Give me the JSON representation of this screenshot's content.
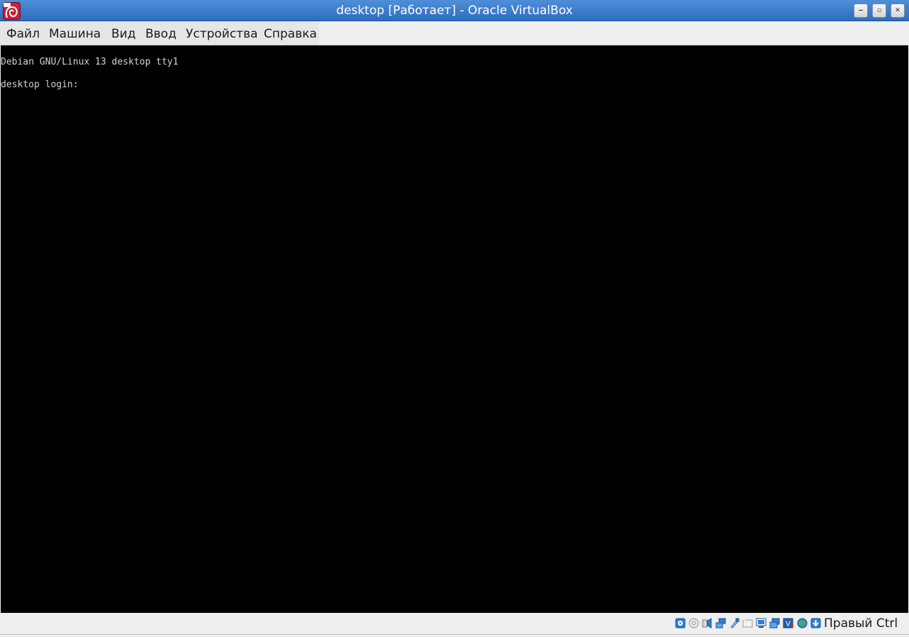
{
  "window": {
    "title": "desktop [Работает] - Oracle VirtualBox",
    "controls": {
      "minimize": "‒",
      "maximize": "▫",
      "close": "✕"
    },
    "app_icon": "virtualbox-app-icon"
  },
  "menu": {
    "items": [
      {
        "label": "Файл"
      },
      {
        "label": "Машина"
      },
      {
        "label": "Вид"
      },
      {
        "label": "Ввод"
      },
      {
        "label": "Устройства"
      },
      {
        "label": "Справка"
      }
    ]
  },
  "console": {
    "lines": [
      "Debian GNU/Linux 13 desktop tty1",
      "desktop login:"
    ],
    "background": "#000000",
    "text_color": "#d3d3d3"
  },
  "status_bar": {
    "indicators": [
      {
        "icon": "hard-disk-icon"
      },
      {
        "icon": "optical-drive-icon"
      },
      {
        "icon": "audio-icon"
      },
      {
        "icon": "network-icon"
      },
      {
        "icon": "usb-icon"
      },
      {
        "icon": "shared-folders-icon"
      },
      {
        "icon": "display-icon"
      },
      {
        "icon": "recording-icon"
      },
      {
        "icon": "virtualization-icon"
      },
      {
        "icon": "guest-additions-icon"
      },
      {
        "icon": "mouse-integration-icon"
      }
    ],
    "host_key": "Правый Ctrl"
  }
}
